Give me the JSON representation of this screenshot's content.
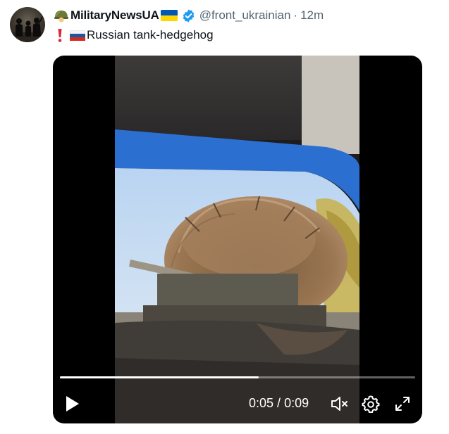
{
  "author": {
    "display_name": "MilitaryNewsUA",
    "handle": "@front_ukrainian",
    "separator": "·",
    "time": "12m",
    "verified": true,
    "avatar": "soldiers-silhouette-avatar"
  },
  "tweet": {
    "text": "Russian tank-hedgehog",
    "prefix_icons": [
      "red-exclamation-icon",
      "russia-flag-icon"
    ]
  },
  "video": {
    "current_time": "0:05",
    "time_separator": " / ",
    "duration": "0:09",
    "progress": 0.56,
    "controls": [
      "play-icon",
      "mute-icon",
      "settings-icon",
      "fullscreen-icon"
    ]
  },
  "colors": {
    "text_primary": "#0f1419",
    "text_secondary": "#536471",
    "verified_blue": "#1d9bf0",
    "ua_blue": "#0057b7",
    "ua_yellow": "#ffd700"
  }
}
